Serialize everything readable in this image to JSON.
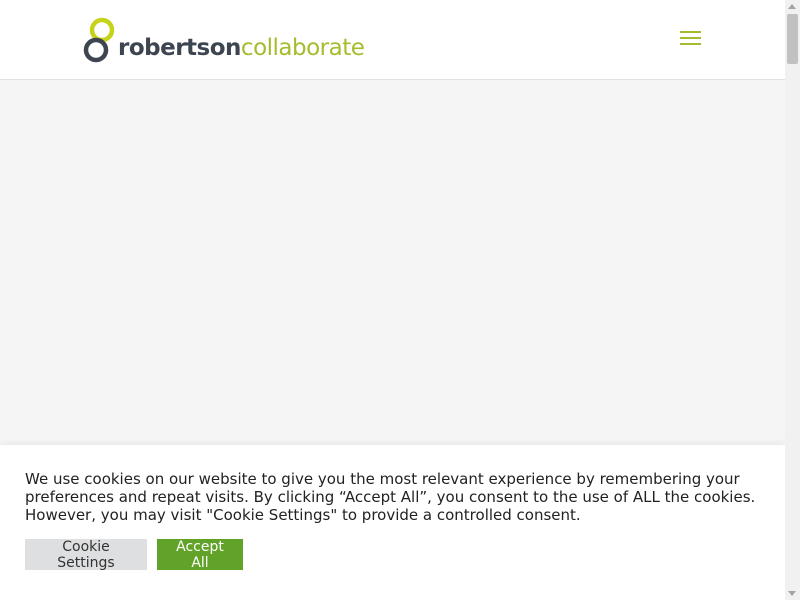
{
  "header": {
    "logo_word1": "robertson",
    "logo_word2": "collaborate",
    "menu_icon": "hamburger-menu-icon"
  },
  "colors": {
    "brand_green": "#a5bc2e",
    "brand_dark": "#3d4650",
    "accept_button": "#61a229",
    "settings_button": "#dedfe0"
  },
  "cookie_banner": {
    "message": "We use cookies on our website to give you the most relevant experience by remembering your preferences and repeat visits. By clicking “Accept All”, you consent to the use of ALL the cookies. However, you may visit \"Cookie Settings\" to provide a controlled consent.",
    "settings_label": "Cookie Settings",
    "accept_label": "Accept All"
  }
}
